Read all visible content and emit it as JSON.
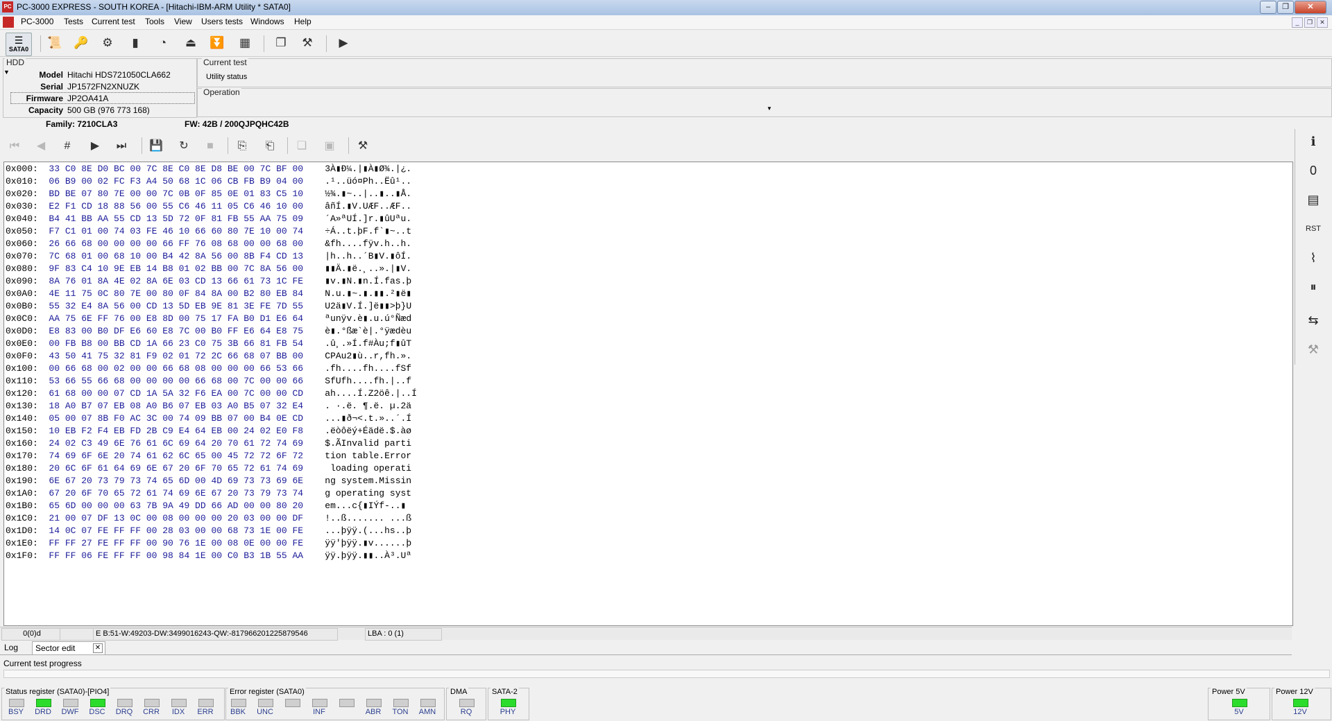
{
  "window": {
    "title": "PC-3000 EXPRESS - SOUTH KOREA - [Hitachi-IBM-ARM Utility * SATA0]",
    "app_icon_text": "PC"
  },
  "menu": [
    "PC-3000",
    "Tests",
    "Current test",
    "Tools",
    "View",
    "Users tests",
    "Windows",
    "Help"
  ],
  "toolbar": {
    "sata_label": "SATA0"
  },
  "hdd": {
    "legend": "HDD",
    "labels": {
      "model": "Model",
      "serial": "Serial",
      "firmware": "Firmware",
      "capacity": "Capacity"
    },
    "model": "Hitachi HDS721050CLA662",
    "serial": "JP1572FN2XNUZK",
    "firmware": "JP2OA41A",
    "capacity": "500 GB (976 773 168)"
  },
  "current_test": {
    "legend": "Current test",
    "status": "Utility status"
  },
  "operation": {
    "legend": "Operation"
  },
  "info": {
    "family": "Family: 7210CLA3",
    "fw": "FW:  42B / 200QJPQHC42B"
  },
  "hex": [
    {
      "addr": "0x000:",
      "bytes": "33 C0 8E D0 BC 00 7C 8E C0 8E D8 BE 00 7C BF 00",
      "ascii": "3À▮Ð¼.|▮À▮Ø¾.|¿."
    },
    {
      "addr": "0x010:",
      "bytes": "06 B9 00 02 FC F3 A4 50 68 1C 06 CB FB B9 04 00",
      "ascii": ".¹..üó¤Ph..Ëû¹.."
    },
    {
      "addr": "0x020:",
      "bytes": "BD BE 07 80 7E 00 00 7C 0B 0F 85 0E 01 83 C5 10",
      "ascii": "½¾.▮~..|..▮..▮Å."
    },
    {
      "addr": "0x030:",
      "bytes": "E2 F1 CD 18 88 56 00 55 C6 46 11 05 C6 46 10 00",
      "ascii": "âñÍ.▮V.UÆF..ÆF.."
    },
    {
      "addr": "0x040:",
      "bytes": "B4 41 BB AA 55 CD 13 5D 72 0F 81 FB 55 AA 75 09",
      "ascii": "´A»ªUÍ.]r.▮ûUªu."
    },
    {
      "addr": "0x050:",
      "bytes": "F7 C1 01 00 74 03 FE 46 10 66 60 80 7E 10 00 74",
      "ascii": "÷Á..t.þF.f`▮~..t"
    },
    {
      "addr": "0x060:",
      "bytes": "26 66 68 00 00 00 00 66 FF 76 08 68 00 00 68 00",
      "ascii": "&fh....fÿv.h..h."
    },
    {
      "addr": "0x070:",
      "bytes": "7C 68 01 00 68 10 00 B4 42 8A 56 00 8B F4 CD 13",
      "ascii": "|h..h..´B▮V.▮ôÍ."
    },
    {
      "addr": "0x080:",
      "bytes": "9F 83 C4 10 9E EB 14 B8 01 02 BB 00 7C 8A 56 00",
      "ascii": "▮▮Ä.▮ë.¸..».|▮V."
    },
    {
      "addr": "0x090:",
      "bytes": "8A 76 01 8A 4E 02 8A 6E 03 CD 13 66 61 73 1C FE",
      "ascii": "▮v.▮N.▮n.Í.fas.þ"
    },
    {
      "addr": "0x0A0:",
      "bytes": "4E 11 75 0C 80 7E 00 80 0F 84 8A 00 B2 80 EB 84",
      "ascii": "N.u.▮~.▮.▮▮.²▮ë▮"
    },
    {
      "addr": "0x0B0:",
      "bytes": "55 32 E4 8A 56 00 CD 13 5D EB 9E 81 3E FE 7D 55",
      "ascii": "U2ä▮V.Í.]ë▮▮>þ}U"
    },
    {
      "addr": "0x0C0:",
      "bytes": "AA 75 6E FF 76 00 E8 8D 00 75 17 FA B0 D1 E6 64",
      "ascii": "ªunÿv.è▮.u.ú°Ñæd"
    },
    {
      "addr": "0x0D0:",
      "bytes": "E8 83 00 B0 DF E6 60 E8 7C 00 B0 FF E6 64 E8 75",
      "ascii": "è▮.°ßæ`è|.°ÿædèu"
    },
    {
      "addr": "0x0E0:",
      "bytes": "00 FB B8 00 BB CD 1A 66 23 C0 75 3B 66 81 FB 54",
      "ascii": ".û¸.»Í.f#Àu;f▮ûT"
    },
    {
      "addr": "0x0F0:",
      "bytes": "43 50 41 75 32 81 F9 02 01 72 2C 66 68 07 BB 00",
      "ascii": "CPAu2▮ù..r,fh.»."
    },
    {
      "addr": "0x100:",
      "bytes": "00 66 68 00 02 00 00 66 68 08 00 00 00 66 53 66",
      "ascii": ".fh....fh....fSf"
    },
    {
      "addr": "0x110:",
      "bytes": "53 66 55 66 68 00 00 00 00 66 68 00 7C 00 00 66",
      "ascii": "SfUfh....fh.|..f"
    },
    {
      "addr": "0x120:",
      "bytes": "61 68 00 00 07 CD 1A 5A 32 F6 EA 00 7C 00 00 CD",
      "ascii": "ah....Í.Z2öê.|..Í"
    },
    {
      "addr": "0x130:",
      "bytes": "18 A0 B7 07 EB 08 A0 B6 07 EB 03 A0 B5 07 32 E4",
      "ascii": ". ·.ë. ¶.ë. µ.2ä"
    },
    {
      "addr": "0x140:",
      "bytes": "05 00 07 8B F0 AC 3C 00 74 09 BB 07 00 B4 0E CD",
      "ascii": "...▮ð¬<.t.»..´.Í"
    },
    {
      "addr": "0x150:",
      "bytes": "10 EB F2 F4 EB FD 2B C9 E4 64 EB 00 24 02 E0 F8",
      "ascii": ".ëòôëý+Éädë.$.àø"
    },
    {
      "addr": "0x160:",
      "bytes": "24 02 C3 49 6E 76 61 6C 69 64 20 70 61 72 74 69",
      "ascii": "$.ÃInvalid parti"
    },
    {
      "addr": "0x170:",
      "bytes": "74 69 6F 6E 20 74 61 62 6C 65 00 45 72 72 6F 72",
      "ascii": "tion table.Error"
    },
    {
      "addr": "0x180:",
      "bytes": "20 6C 6F 61 64 69 6E 67 20 6F 70 65 72 61 74 69",
      "ascii": " loading operati"
    },
    {
      "addr": "0x190:",
      "bytes": "6E 67 20 73 79 73 74 65 6D 00 4D 69 73 73 69 6E",
      "ascii": "ng system.Missin"
    },
    {
      "addr": "0x1A0:",
      "bytes": "67 20 6F 70 65 72 61 74 69 6E 67 20 73 79 73 74",
      "ascii": "g operating syst"
    },
    {
      "addr": "0x1B0:",
      "bytes": "65 6D 00 00 00 63 7B 9A 49 DD 66 AD 00 00 80 20",
      "ascii": "em...c{▮IÝf-..▮ "
    },
    {
      "addr": "0x1C0:",
      "bytes": "21 00 07 DF 13 0C 00 08 00 00 00 20 03 00 00 DF",
      "ascii": "!..ß....... ...ß"
    },
    {
      "addr": "0x1D0:",
      "bytes": "14 0C 07 FE FF FF 00 28 03 00 00 68 73 1E 00 FE",
      "ascii": "...þÿÿ.(...hs..þ"
    },
    {
      "addr": "0x1E0:",
      "bytes": "FF FF 27 FE FF FF 00 90 76 1E 00 08 0E 00 00 FE",
      "ascii": "ÿÿ'þÿÿ.▮v......þ"
    },
    {
      "addr": "0x1F0:",
      "bytes": "FF FF 06 FE FF FF 00 98 84 1E 00 C0 B3 1B 55 AA",
      "ascii": "ÿÿ.þÿÿ.▮▮..À³.Uª"
    }
  ],
  "statusbar": {
    "pos": "0(0)d",
    "values": "E B:51-W:49203-DW:3499016243-QW:-817966201225879546",
    "lba": "LBA : 0 (1)"
  },
  "tabs": {
    "log": "Log",
    "sector_edit": "Sector edit",
    "close": "✕"
  },
  "progress_label": "Current test progress",
  "registers": {
    "status": {
      "title": "Status register (SATA0)-[PIO4]",
      "leds": [
        {
          "name": "BSY",
          "on": false
        },
        {
          "name": "DRD",
          "on": true
        },
        {
          "name": "DWF",
          "on": false
        },
        {
          "name": "DSC",
          "on": true
        },
        {
          "name": "DRQ",
          "on": false
        },
        {
          "name": "CRR",
          "on": false
        },
        {
          "name": "IDX",
          "on": false
        },
        {
          "name": "ERR",
          "on": false
        }
      ]
    },
    "error": {
      "title": "Error register (SATA0)",
      "leds": [
        {
          "name": "BBK",
          "on": false
        },
        {
          "name": "UNC",
          "on": false
        },
        {
          "name": "",
          "on": false
        },
        {
          "name": "INF",
          "on": false
        },
        {
          "name": "",
          "on": false
        },
        {
          "name": "ABR",
          "on": false
        },
        {
          "name": "TON",
          "on": false
        },
        {
          "name": "AMN",
          "on": false
        }
      ]
    },
    "dma": {
      "title": "DMA",
      "leds": [
        {
          "name": "RQ",
          "on": false
        }
      ]
    },
    "sata2": {
      "title": "SATA-2",
      "leds": [
        {
          "name": "PHY",
          "on": true
        }
      ]
    },
    "power5": {
      "title": "Power 5V",
      "leds": [
        {
          "name": "5V",
          "on": true
        }
      ]
    },
    "power12": {
      "title": "Power 12V",
      "leds": [
        {
          "name": "12V",
          "on": true
        }
      ]
    }
  },
  "colors": {
    "led_on": "#2cdc2c",
    "led_off": "#cfcfcf",
    "hex_bytes": "#1c1c9a"
  }
}
